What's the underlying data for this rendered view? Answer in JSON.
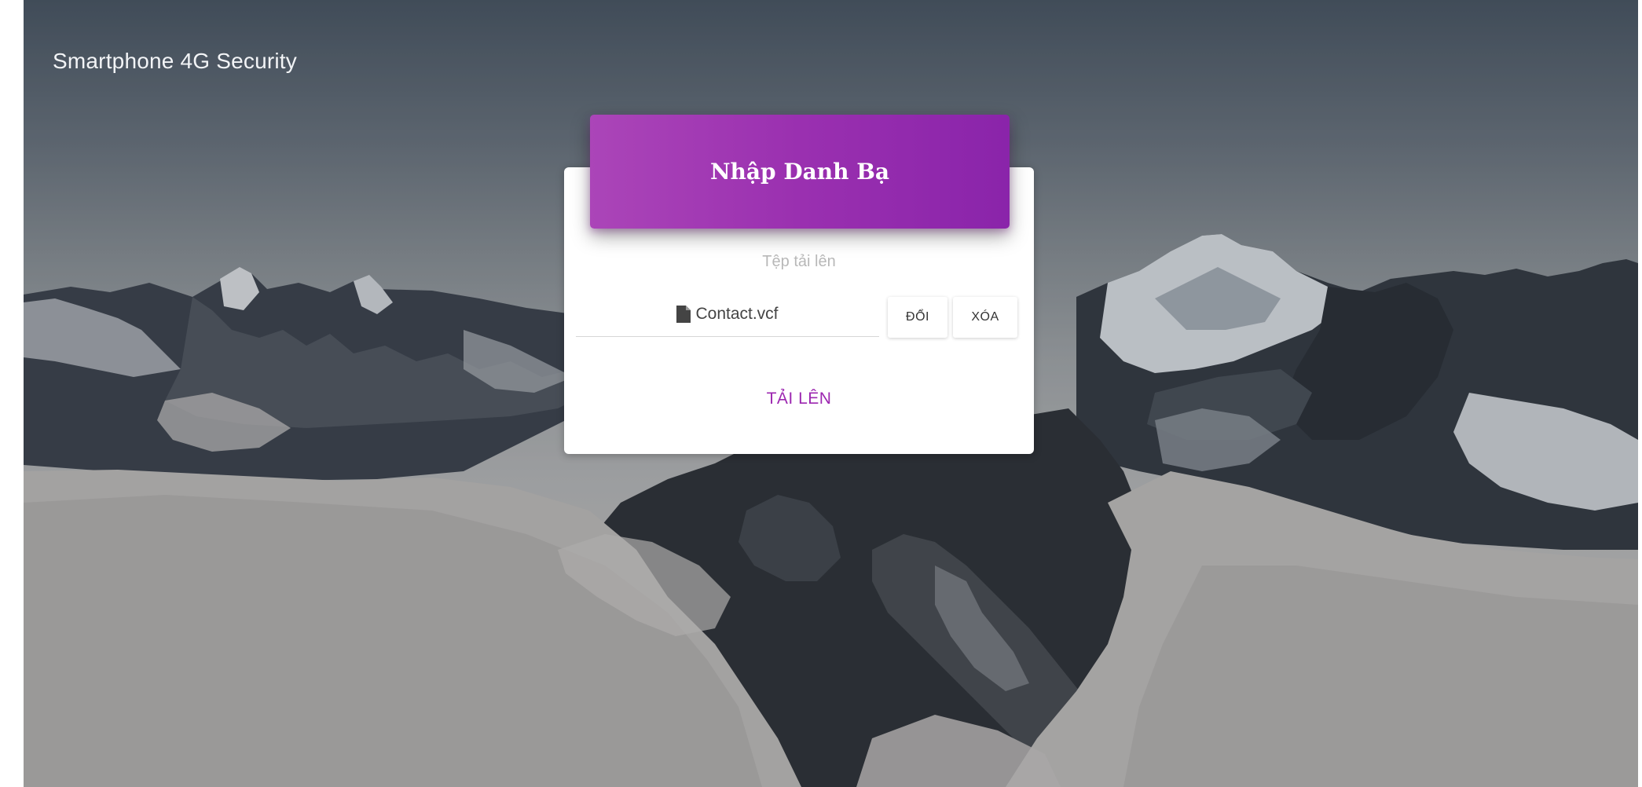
{
  "header": {
    "brand": "Smartphone 4G Security"
  },
  "dialog": {
    "title": "Nhập Danh Bạ",
    "file_label": "Tệp tải lên",
    "file_name": "Contact.vcf",
    "change_label": "ĐỔI",
    "remove_label": "XÓA",
    "upload_label": "TẢI LÊN"
  },
  "colors": {
    "accent": "#9c27b0",
    "header_gradient_start": "#ab45b8",
    "header_gradient_end": "#8a24aa",
    "brand_text": "#f2f4f6"
  },
  "icons": {
    "file": "file-icon"
  }
}
